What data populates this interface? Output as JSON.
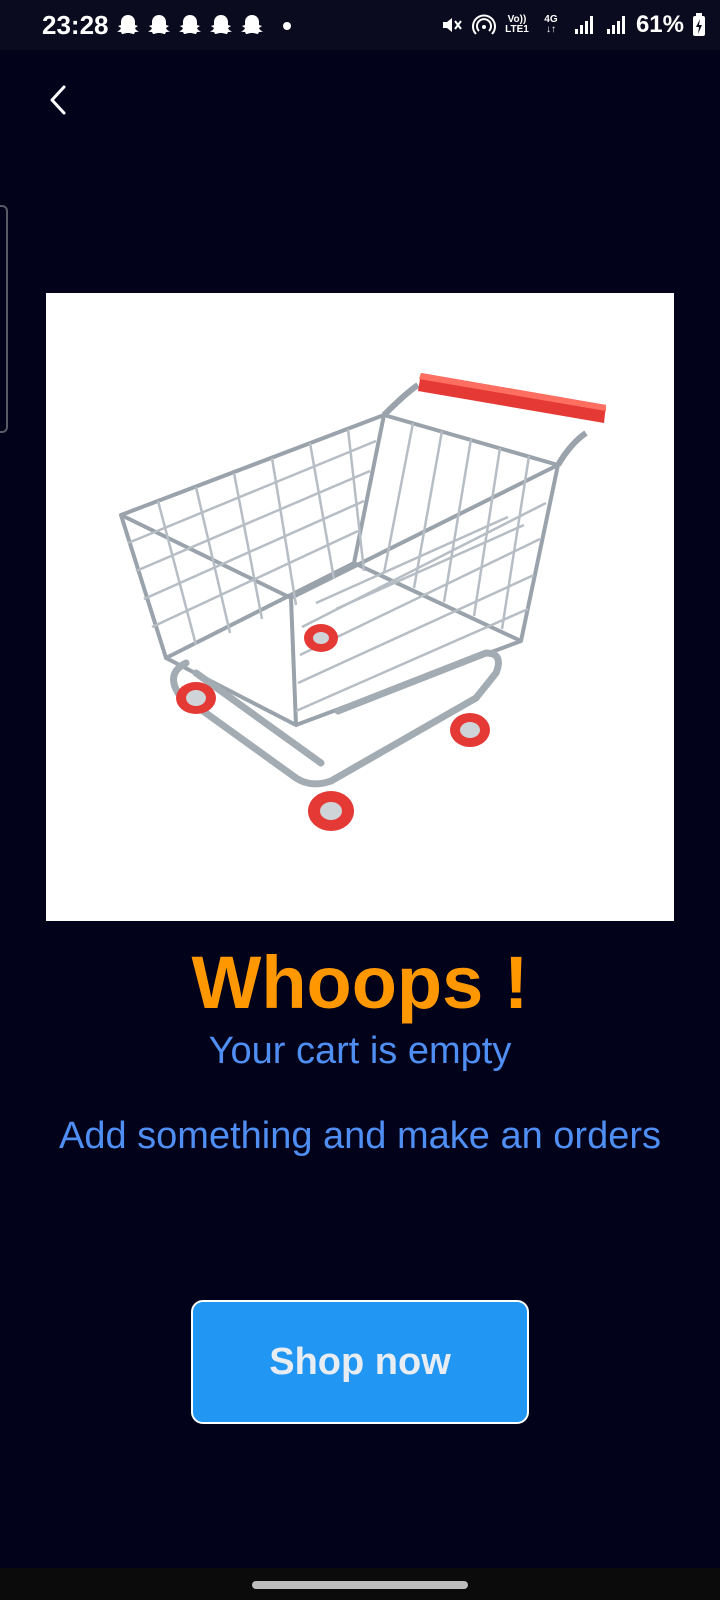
{
  "status_bar": {
    "time": "23:28",
    "notification_icons": [
      "snapchat-ghost-icon",
      "snapchat-ghost-icon",
      "snapchat-ghost-icon",
      "snapchat-ghost-icon",
      "snapchat-ghost-icon"
    ],
    "network_label_top": "Vo))",
    "network_label_bottom": "LTE1",
    "network_type": "4G",
    "battery": "61%"
  },
  "navigation": {
    "back_icon": "chevron-left-icon"
  },
  "empty_state": {
    "image": "shopping-cart-illustration",
    "headline": "Whoops !",
    "subtitle": "Your cart is empty",
    "hint": "Add something and make an orders"
  },
  "actions": {
    "shop_now_label": "Shop now"
  },
  "colors": {
    "background": "#02021b",
    "headline": "#ff9800",
    "text_blue": "#4f8ef2",
    "button": "#2196f3",
    "cart_handle": "#e53935"
  }
}
